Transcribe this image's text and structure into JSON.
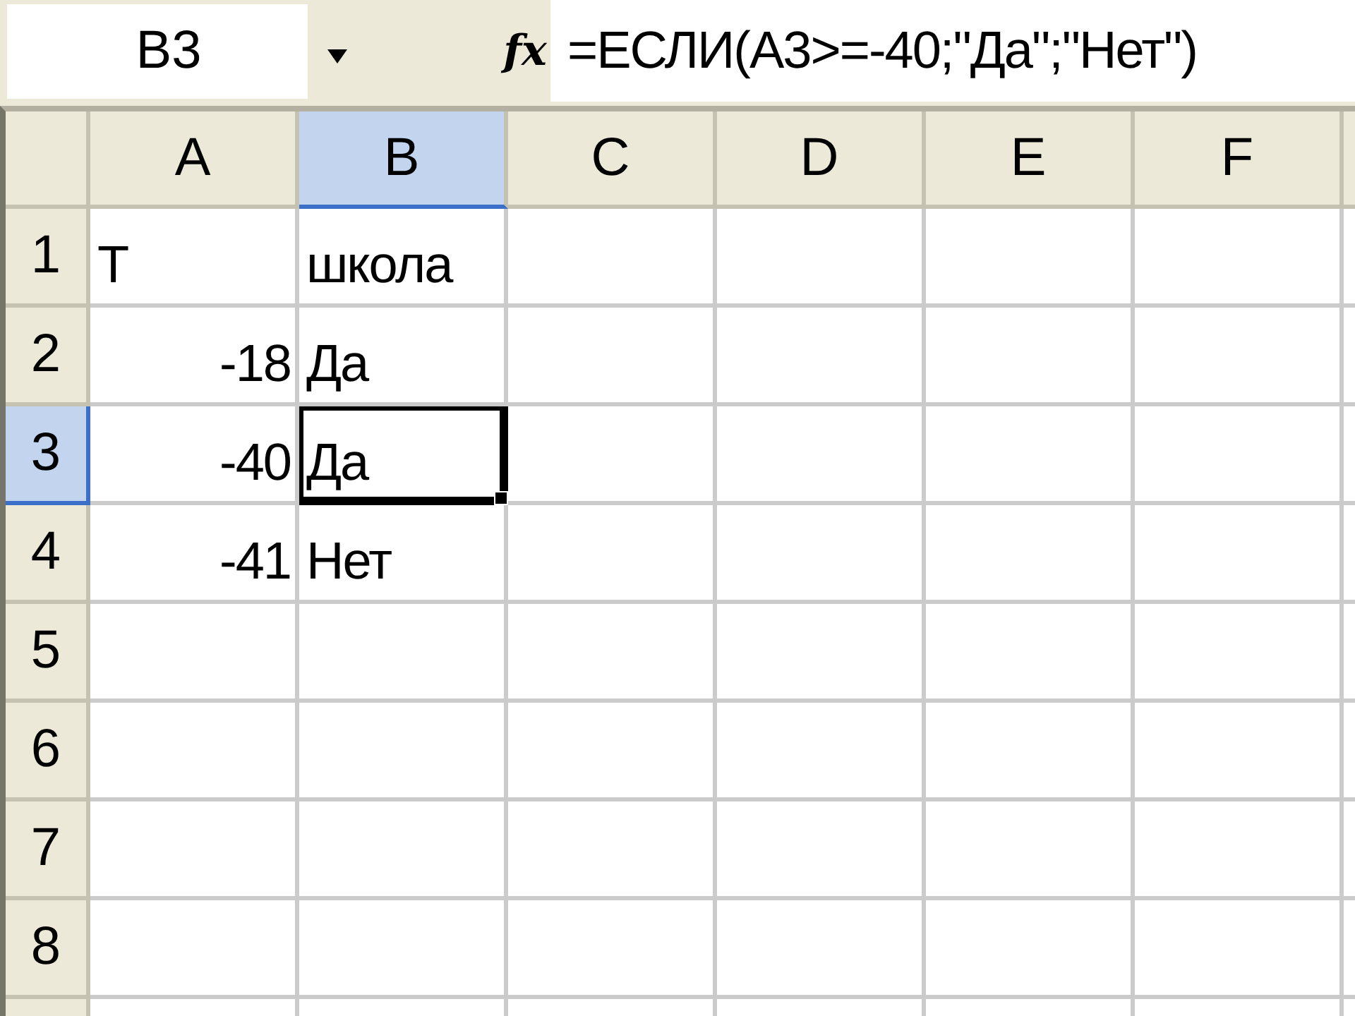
{
  "formula_bar": {
    "name_box": "B3",
    "function_button": "fx",
    "formula": "=ЕСЛИ(A3>=-40;\"Да\";\"Нет\")"
  },
  "sheet": {
    "columns": [
      {
        "label": "A",
        "selected": false
      },
      {
        "label": "B",
        "selected": true
      },
      {
        "label": "C",
        "selected": false
      },
      {
        "label": "D",
        "selected": false
      },
      {
        "label": "E",
        "selected": false
      },
      {
        "label": "F",
        "selected": false
      }
    ],
    "rows": [
      {
        "label": "1",
        "selected": false,
        "cells": [
          {
            "kind": "text",
            "text": "T",
            "selected": false
          },
          {
            "kind": "text",
            "text": "школа",
            "selected": false
          }
        ]
      },
      {
        "label": "2",
        "selected": false,
        "cells": [
          {
            "kind": "number",
            "text": "-18",
            "selected": false
          },
          {
            "kind": "text",
            "text": "Да",
            "selected": false
          }
        ]
      },
      {
        "label": "3",
        "selected": true,
        "cells": [
          {
            "kind": "number",
            "text": "-40",
            "selected": false
          },
          {
            "kind": "text",
            "text": "Да",
            "selected": true
          }
        ]
      },
      {
        "label": "4",
        "selected": false,
        "cells": [
          {
            "kind": "number",
            "text": "-41",
            "selected": false
          },
          {
            "kind": "text",
            "text": "Нет",
            "selected": false
          }
        ]
      },
      {
        "label": "5",
        "selected": false
      },
      {
        "label": "6",
        "selected": false
      },
      {
        "label": "7",
        "selected": false
      },
      {
        "label": "8",
        "selected": false
      }
    ]
  }
}
